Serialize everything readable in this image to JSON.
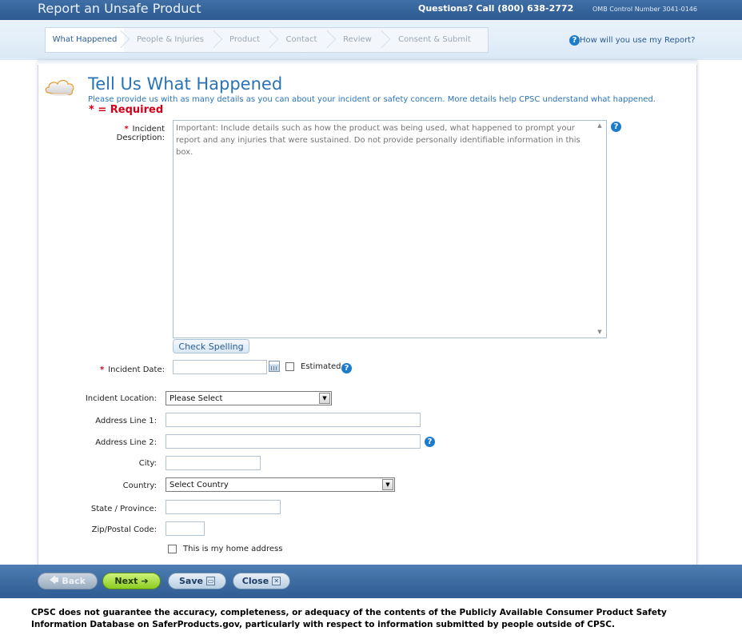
{
  "header": {
    "title": "Report an Unsafe Product",
    "phone_text": "Questions? Call (800) 638-2772",
    "omb_text": "OMB Control Number 3041-0146"
  },
  "steps": [
    {
      "label": "What Happened",
      "active": true
    },
    {
      "label": "People & Injuries",
      "active": false
    },
    {
      "label": "Product",
      "active": false
    },
    {
      "label": "Contact",
      "active": false
    },
    {
      "label": "Review",
      "active": false
    },
    {
      "label": "Consent & Submit",
      "active": false
    }
  ],
  "help_link": "How will you use my Report?",
  "page": {
    "title": "Tell Us What Happened",
    "subtitle": "Please provide us with as many details as you can about your incident or safety concern. More details help CPSC understand what happened.",
    "required_note": "* = Required"
  },
  "form": {
    "required_mark": "*",
    "incident_description_label": "Incident Description:",
    "incident_description_placeholder": "Important: Include details such as how the product was being used, what happened to prompt your report and any injuries that were sustained. Do not provide personally identifiable information in this box.",
    "check_spelling": "Check Spelling",
    "incident_date_label": "Incident Date:",
    "incident_date_value": "",
    "estimated_label": "Estimated",
    "incident_location_label": "Incident Location:",
    "incident_location_value": "Please Select",
    "address1_label": "Address Line 1:",
    "address2_label": "Address Line 2:",
    "city_label": "City:",
    "country_label": "Country:",
    "country_value": "Select Country",
    "state_label": "State / Province:",
    "zip_label": "Zip/Postal Code:",
    "home_address_label": "This is my home address"
  },
  "footer": {
    "back": "Back",
    "next": "Next",
    "save": "Save",
    "close": "Close"
  },
  "disclaimer": "CPSC does not guarantee the accuracy, completeness, or adequacy of the contents of the Publicly Available Consumer Product Safety Information Database on SaferProducts.gov, particularly with respect to information submitted by people outside of CPSC.",
  "colors": {
    "header": "#2d5a90",
    "title_blue": "#2a73b6",
    "required_red": "#d4001a",
    "next_green": "#8ccc22"
  }
}
